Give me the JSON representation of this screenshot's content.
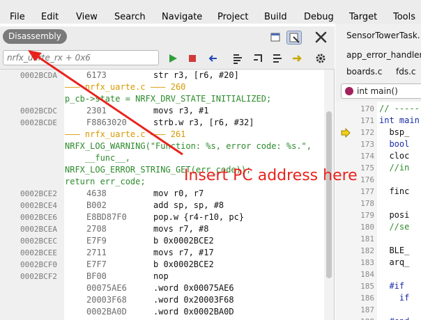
{
  "menu": [
    "File",
    "Edit",
    "View",
    "Search",
    "Navigate",
    "Project",
    "Build",
    "Debug",
    "Target",
    "Tools"
  ],
  "disassembly": {
    "tab_label": "Disassembly",
    "pc_input_placeholder": "nrfx_uarte_rx + 0x6",
    "rows": [
      {
        "kind": "ins",
        "addr": "0002BCDA",
        "opcode": "6173",
        "text": "str r3, [r6, #20]"
      },
      {
        "kind": "hdr",
        "text": "——— nrfx_uarte.c ——— 260"
      },
      {
        "kind": "src",
        "text": "p_cb->state = NRFX_DRV_STATE_INITIALIZED;"
      },
      {
        "kind": "ins",
        "addr": "0002BCDC",
        "opcode": "2301",
        "text": "movs r3, #1"
      },
      {
        "kind": "ins",
        "addr": "0002BCDE",
        "opcode": "F8863020",
        "text": "strb.w r3, [r6, #32]"
      },
      {
        "kind": "hdr",
        "text": "——— nrfx_uarte.c ——— 261"
      },
      {
        "kind": "src",
        "text": "NRFX_LOG_WARNING(\"Function: %s, error code: %s.\","
      },
      {
        "kind": "src",
        "text": "    __func__,"
      },
      {
        "kind": "src",
        "text": "NRFX_LOG_ERROR_STRING_GET(err_code));"
      },
      {
        "kind": "src",
        "text": "return err_code;"
      },
      {
        "kind": "ins",
        "addr": "0002BCE2",
        "opcode": "4638",
        "text": "mov r0, r7"
      },
      {
        "kind": "ins",
        "addr": "0002BCE4",
        "opcode": "B002",
        "text": "add sp, sp, #8"
      },
      {
        "kind": "ins",
        "addr": "0002BCE6",
        "opcode": "E8BD87F0",
        "text": "pop.w {r4-r10, pc}"
      },
      {
        "kind": "ins",
        "addr": "0002BCEA",
        "opcode": "2708",
        "text": "movs r7, #8"
      },
      {
        "kind": "ins",
        "addr": "0002BCEC",
        "opcode": "E7F9",
        "text": "b 0x0002BCE2"
      },
      {
        "kind": "ins",
        "addr": "0002BCEE",
        "opcode": "2711",
        "text": "movs r7, #17"
      },
      {
        "kind": "ins",
        "addr": "0002BCF0",
        "opcode": "E7F7",
        "text": "b 0x0002BCE2"
      },
      {
        "kind": "ins",
        "addr": "0002BCF2",
        "opcode": "BF00",
        "text": "nop"
      },
      {
        "kind": "ins",
        "addr": "",
        "opcode": "00075AE6",
        "text": ".word 0x00075AE6"
      },
      {
        "kind": "ins",
        "addr": "",
        "opcode": "20003F68",
        "text": ".word 0x20003F68"
      },
      {
        "kind": "ins",
        "addr": "",
        "opcode": "0002BA0D",
        "text": ".word 0x0002BA0D"
      }
    ]
  },
  "right": {
    "tabs": [
      "SensorTowerTask.",
      "app_error_handler",
      "boards.c",
      "fds.c"
    ],
    "function_combo": "int main()",
    "lines": [
      {
        "n": "170",
        "text": "// -----",
        "color": "#2c8a2c"
      },
      {
        "n": "171",
        "text": "int main",
        "color": "#1a2aa8"
      },
      {
        "n": "172",
        "text": "  bsp_",
        "color": "#111111"
      },
      {
        "n": "173",
        "text": "  bool",
        "color": "#1a2aa8"
      },
      {
        "n": "174",
        "text": "  cloc",
        "color": "#111111"
      },
      {
        "n": "175",
        "text": "  //in",
        "color": "#2c8a2c"
      },
      {
        "n": "176",
        "text": "",
        "color": "#111111"
      },
      {
        "n": "177",
        "text": "  finc",
        "color": "#111111"
      },
      {
        "n": "178",
        "text": "",
        "color": "#111111"
      },
      {
        "n": "179",
        "text": "  posi",
        "color": "#111111"
      },
      {
        "n": "180",
        "text": "  //se",
        "color": "#2c8a2c"
      },
      {
        "n": "181",
        "text": "",
        "color": "#111111"
      },
      {
        "n": "182",
        "text": "  BLE_",
        "color": "#111111"
      },
      {
        "n": "183",
        "text": "  arq_",
        "color": "#111111"
      },
      {
        "n": "184",
        "text": "",
        "color": "#111111"
      },
      {
        "n": "185",
        "text": "  #if",
        "color": "#1a2aa8"
      },
      {
        "n": "186",
        "text": "    if",
        "color": "#1a2aa8"
      },
      {
        "n": "187",
        "text": "",
        "color": "#111111"
      },
      {
        "n": "188",
        "text": "  #end",
        "color": "#1a2aa8"
      }
    ]
  },
  "annotation": "Insert PC address here",
  "colors": {
    "annotation": "#e8231c",
    "source": "#2c8a2c",
    "file_header": "#d69a00"
  }
}
